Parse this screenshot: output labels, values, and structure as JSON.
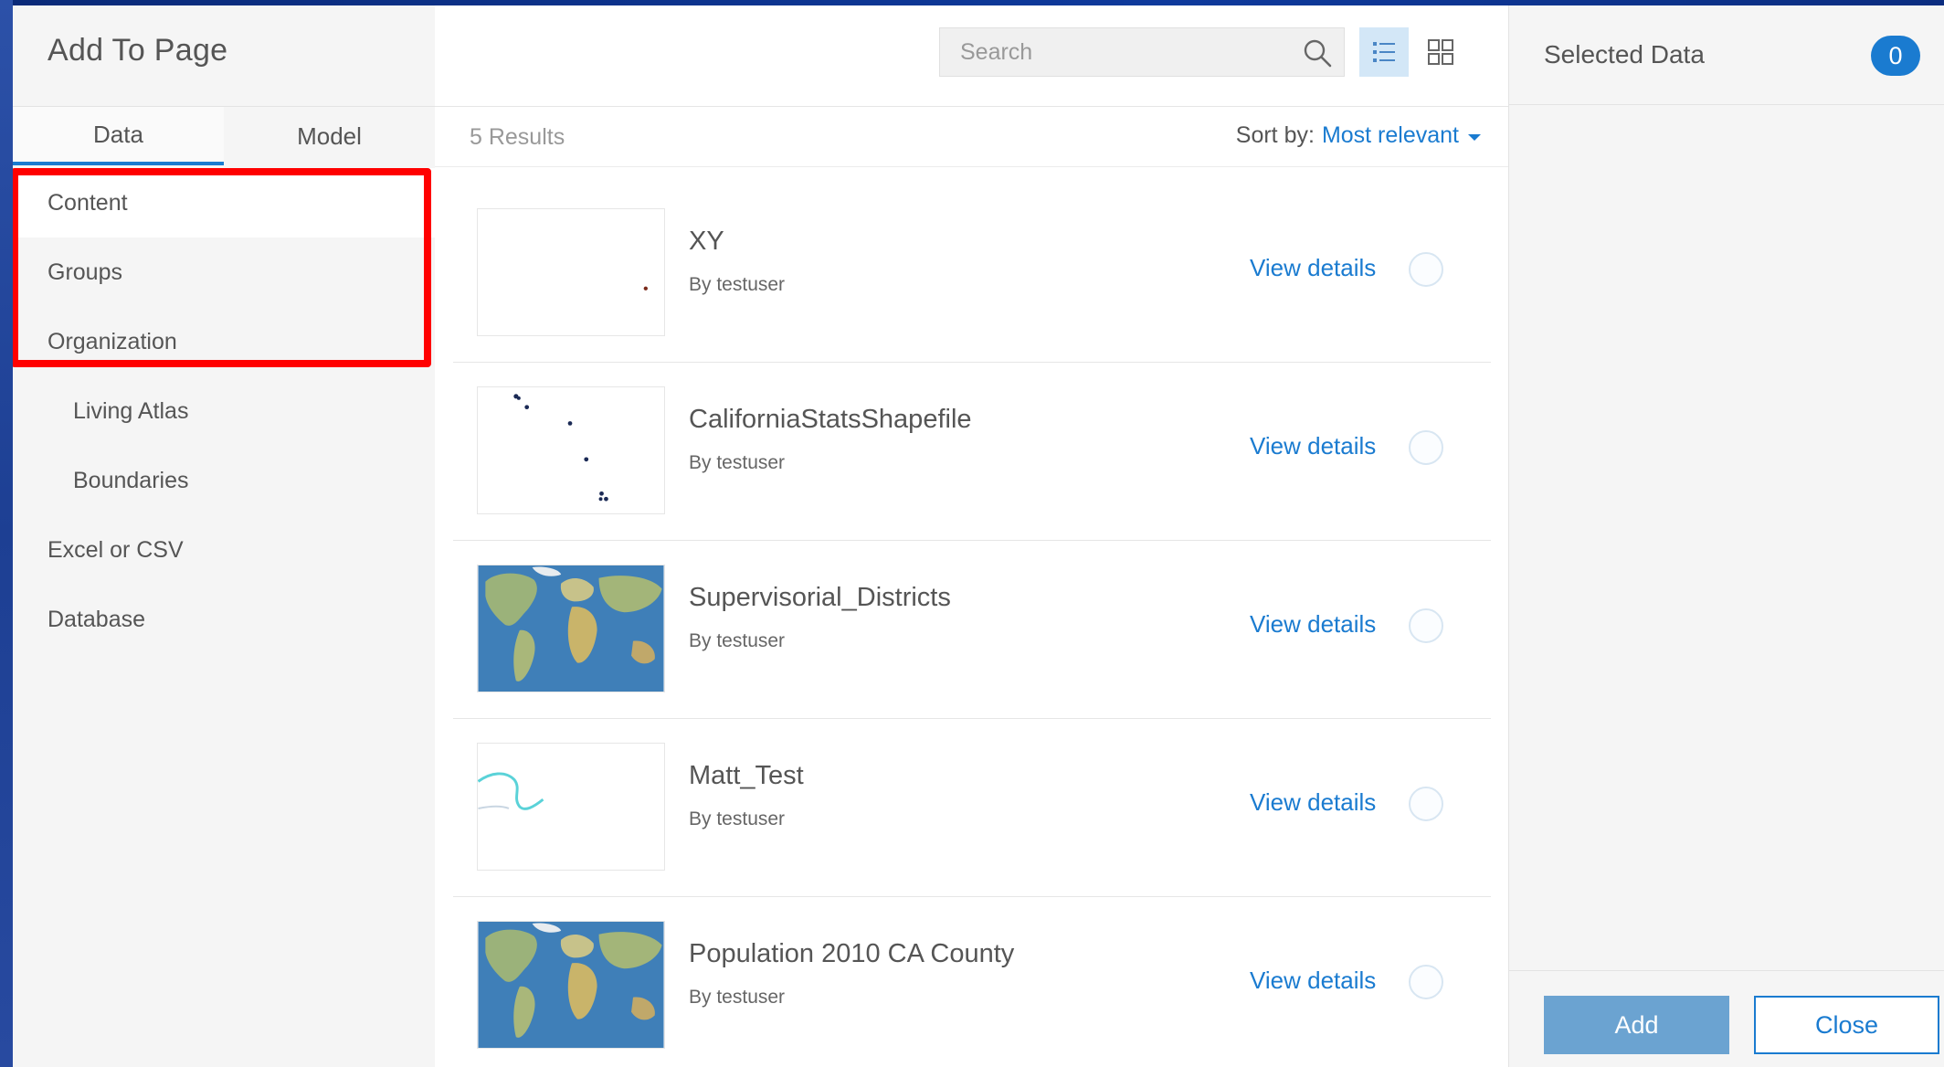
{
  "dialog": {
    "title": "Add To Page"
  },
  "left_tabs": [
    {
      "label": "Data",
      "active": true
    },
    {
      "label": "Model",
      "active": false
    }
  ],
  "nav": {
    "items": [
      {
        "label": "Content"
      },
      {
        "label": "Groups"
      },
      {
        "label": "Organization"
      },
      {
        "label": "Living Atlas"
      },
      {
        "label": "Boundaries"
      },
      {
        "label": "Excel or CSV"
      },
      {
        "label": "Database"
      }
    ]
  },
  "search": {
    "placeholder": "Search",
    "value": ""
  },
  "toolbar": {
    "list_view_icon": "list-view-icon",
    "grid_view_icon": "grid-view-icon"
  },
  "results": {
    "count_label": "5 Results",
    "sort_label": "Sort by:",
    "sort_value": "Most relevant",
    "items": [
      {
        "title": "XY",
        "owner": "By testuser",
        "action": "View details",
        "thumbnail": "point-map"
      },
      {
        "title": "CaliforniaStatsShapefile",
        "owner": "By testuser",
        "action": "View details",
        "thumbnail": "scatter-points"
      },
      {
        "title": "Supervisorial_Districts",
        "owner": "By testuser",
        "action": "View details",
        "thumbnail": "world-map"
      },
      {
        "title": "Matt_Test",
        "owner": "By testuser",
        "action": "View details",
        "thumbnail": "line-map"
      },
      {
        "title": "Population 2010 CA County",
        "owner": "By testuser",
        "action": "View details",
        "thumbnail": "world-map"
      }
    ]
  },
  "selected": {
    "title": "Selected Data",
    "count": "0"
  },
  "footer": {
    "add_label": "Add",
    "close_label": "Close"
  },
  "colors": {
    "accent": "#1a7bd0",
    "highlight": "#ff0000"
  }
}
